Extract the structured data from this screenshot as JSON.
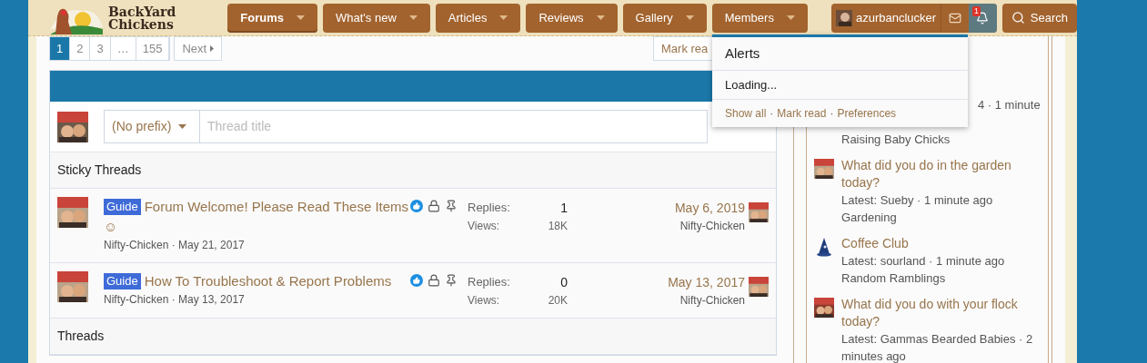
{
  "header": {
    "logo": {
      "line1": "BackYard",
      "line2": "Chickens"
    },
    "nav": [
      {
        "label": "Forums",
        "selected": true
      },
      {
        "label": "What's new",
        "selected": false
      },
      {
        "label": "Articles",
        "selected": false
      },
      {
        "label": "Reviews",
        "selected": false
      },
      {
        "label": "Gallery",
        "selected": false
      },
      {
        "label": "Members",
        "selected": false
      }
    ],
    "user": {
      "name": "azurbanclucker",
      "alert_count": "1",
      "alerts_open": true
    },
    "search": "Search"
  },
  "pagination": {
    "pages": [
      {
        "label": "1",
        "selected": true
      },
      {
        "label": "2",
        "selected": false
      },
      {
        "label": "3",
        "selected": false
      },
      {
        "label": "…",
        "selected": false
      },
      {
        "label": "155",
        "selected": false
      }
    ],
    "next": "Next",
    "mark_read": "Mark rea"
  },
  "new_thread": {
    "prefix": "(No prefix)",
    "placeholder": "Thread title"
  },
  "sections": [
    {
      "title": "Sticky Threads",
      "threads": [
        {
          "prefix": "Guide",
          "title": "Forum Welcome! Please Read These Items",
          "emoji": "☺",
          "liked": true,
          "locked": true,
          "pinned": true,
          "meta": "Nifty-Chicken · May 21, 2017",
          "replies_label": "Replies:",
          "replies": "1",
          "views_label": "Views:",
          "views": "18K",
          "last_date": "May 6, 2019",
          "last_user": "Nifty-Chicken"
        },
        {
          "prefix": "Guide",
          "title": "How To Troubleshoot & Report Problems",
          "liked": true,
          "locked": true,
          "pinned": true,
          "meta": "Nifty-Chicken · May 13, 2017",
          "replies_label": "Replies:",
          "replies": "0",
          "views_label": "Views:",
          "views": "20K",
          "last_date": "May 13, 2017",
          "last_user": "Nifty-Chicken"
        }
      ]
    },
    {
      "title": "Threads"
    }
  ],
  "alerts_popup": {
    "title": "Alerts",
    "status": "Loading...",
    "links": [
      "Show all",
      "Mark read",
      "Preferences"
    ],
    "separator": "·"
  },
  "sidebar": [
    {
      "kind": "covered",
      "latest": "4 · 1 minute",
      "forum": "Raising Baby Chicks"
    },
    {
      "title": "What did you do in the garden today?",
      "latest": "Latest: Sueby · 1 minute ago",
      "forum": "Gardening"
    },
    {
      "kind": "hat",
      "title": "Coffee Club",
      "latest": "Latest: sourland · 1 minute ago",
      "forum": "Random Ramblings"
    },
    {
      "title": "What did you do with your flock today?",
      "latest": "Latest: Gammas Bearded Babies · 2 minutes ago"
    }
  ]
}
